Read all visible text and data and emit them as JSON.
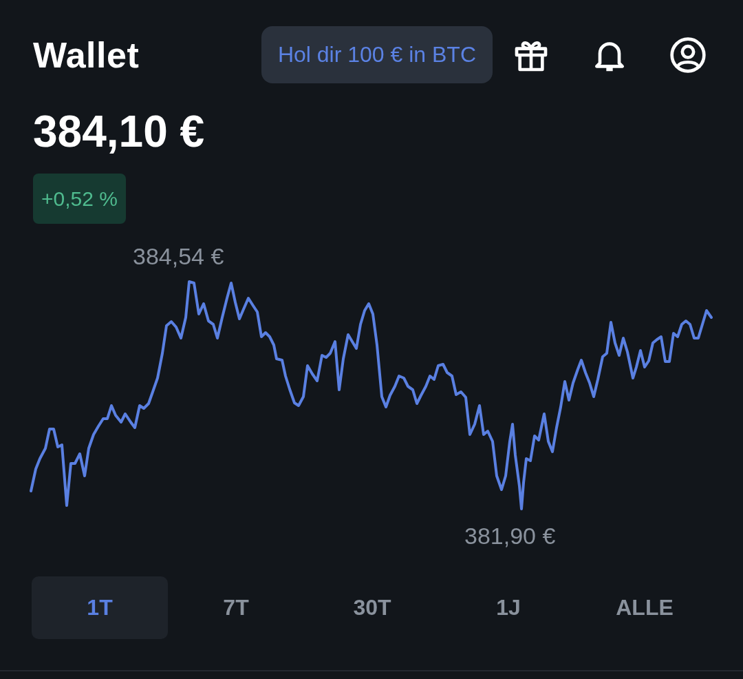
{
  "header": {
    "title": "Wallet",
    "promo_button": "Hol dir 100 € in BTC"
  },
  "balance": {
    "amount": "384,10 €",
    "change": "+0,52 %"
  },
  "chart": {
    "high_label": "384,54 €",
    "low_label": "381,90 €"
  },
  "ranges": [
    {
      "label": "1T",
      "selected": true
    },
    {
      "label": "7T",
      "selected": false
    },
    {
      "label": "30T",
      "selected": false
    },
    {
      "label": "1J",
      "selected": false
    },
    {
      "label": "ALLE",
      "selected": false
    }
  ]
}
